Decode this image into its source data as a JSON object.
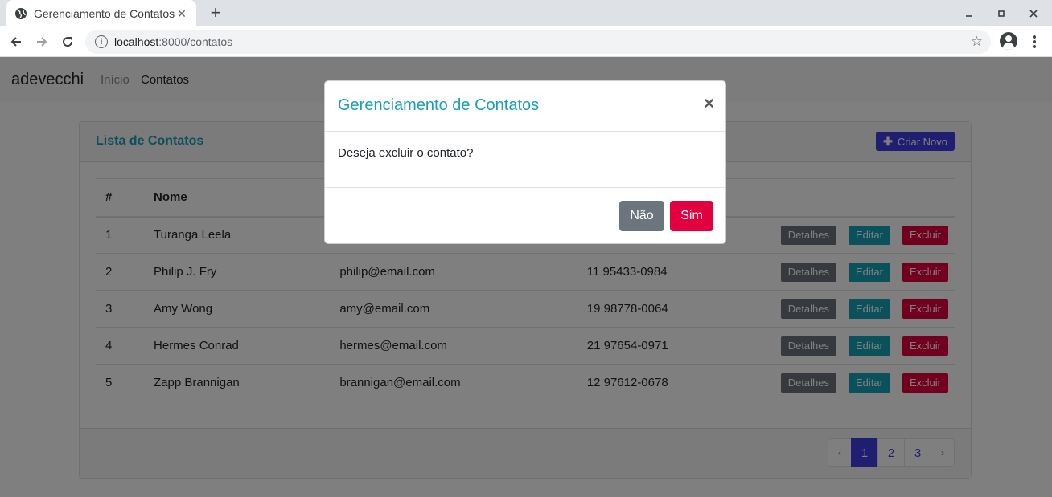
{
  "browser": {
    "tab_title": "Gerenciamento de Contatos",
    "new_tab": "+",
    "tab_close": "✕",
    "url_host": "localhost",
    "url_rest": ":8000/contatos",
    "star": "☆"
  },
  "navbar": {
    "brand": "adevecchi",
    "links": [
      "Início",
      "Contatos"
    ]
  },
  "card": {
    "title": "Lista de Contatos",
    "create_icon": "✚",
    "create_label": "Criar Novo"
  },
  "table": {
    "headers": [
      "#",
      "Nome"
    ],
    "rows": [
      {
        "id": "1",
        "name": "Turanga Leela",
        "email": "",
        "phone": ""
      },
      {
        "id": "2",
        "name": "Philip J. Fry",
        "email": "philip@email.com",
        "phone": "11 95433-0984"
      },
      {
        "id": "3",
        "name": "Amy Wong",
        "email": "amy@email.com",
        "phone": "19 98778-0064"
      },
      {
        "id": "4",
        "name": "Hermes Conrad",
        "email": "hermes@email.com",
        "phone": "21 97654-0971"
      },
      {
        "id": "5",
        "name": "Zapp Brannigan",
        "email": "brannigan@email.com",
        "phone": "12 97612-0678"
      }
    ],
    "actions": {
      "details": "Detalhes",
      "edit": "Editar",
      "delete": "Excluir"
    }
  },
  "pagination": {
    "prev": "‹",
    "pages": [
      "1",
      "2",
      "3"
    ],
    "active_page": "1",
    "next": "›"
  },
  "modal": {
    "title": "Gerenciamento de Contatos",
    "close": "×",
    "message": "Deseja excluir o contato?",
    "no_label": "Não",
    "yes_label": "Sim"
  }
}
